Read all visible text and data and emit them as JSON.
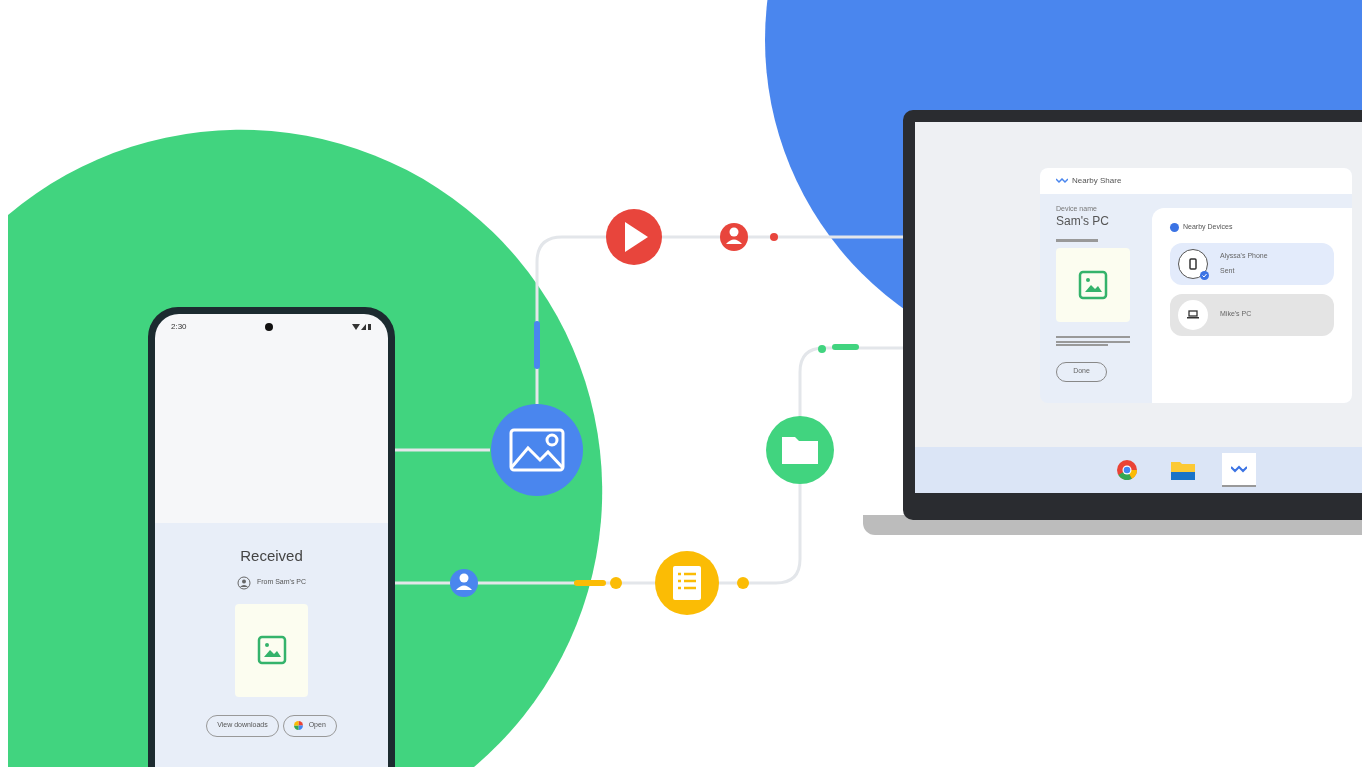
{
  "phone": {
    "status_time": "2:30",
    "title": "Received",
    "sender": "From Sam's PC",
    "buttons": [
      {
        "label": "View downloads",
        "kind": "plain"
      },
      {
        "label": "Open",
        "kind": "photos"
      }
    ]
  },
  "laptop": {
    "dialog": {
      "title": "Nearby Share",
      "device_label": "Device name",
      "device_name": "Sam's PC",
      "done": "Done",
      "devices_heading": "Nearby Devices",
      "devices": [
        {
          "name": "Alyssa's Phone",
          "status": "Sent",
          "kind": "phone",
          "selected": true
        },
        {
          "name": "Mike's PC",
          "kind": "laptop",
          "selected": false
        }
      ]
    },
    "taskbar": [
      {
        "kind": "browser",
        "selected": false
      },
      {
        "kind": "folder",
        "selected": false
      },
      {
        "kind": "share",
        "selected": true
      }
    ]
  }
}
